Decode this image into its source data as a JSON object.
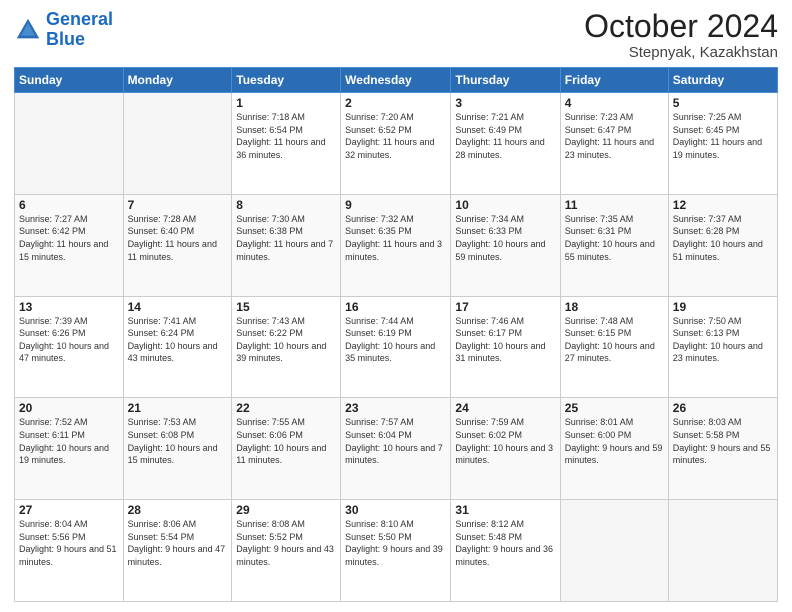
{
  "header": {
    "logo_line1": "General",
    "logo_line2": "Blue",
    "month_title": "October 2024",
    "location": "Stepnyak, Kazakhstan"
  },
  "weekdays": [
    "Sunday",
    "Monday",
    "Tuesday",
    "Wednesday",
    "Thursday",
    "Friday",
    "Saturday"
  ],
  "weeks": [
    [
      {
        "day": "",
        "sunrise": "",
        "sunset": "",
        "daylight": ""
      },
      {
        "day": "",
        "sunrise": "",
        "sunset": "",
        "daylight": ""
      },
      {
        "day": "1",
        "sunrise": "Sunrise: 7:18 AM",
        "sunset": "Sunset: 6:54 PM",
        "daylight": "Daylight: 11 hours and 36 minutes."
      },
      {
        "day": "2",
        "sunrise": "Sunrise: 7:20 AM",
        "sunset": "Sunset: 6:52 PM",
        "daylight": "Daylight: 11 hours and 32 minutes."
      },
      {
        "day": "3",
        "sunrise": "Sunrise: 7:21 AM",
        "sunset": "Sunset: 6:49 PM",
        "daylight": "Daylight: 11 hours and 28 minutes."
      },
      {
        "day": "4",
        "sunrise": "Sunrise: 7:23 AM",
        "sunset": "Sunset: 6:47 PM",
        "daylight": "Daylight: 11 hours and 23 minutes."
      },
      {
        "day": "5",
        "sunrise": "Sunrise: 7:25 AM",
        "sunset": "Sunset: 6:45 PM",
        "daylight": "Daylight: 11 hours and 19 minutes."
      }
    ],
    [
      {
        "day": "6",
        "sunrise": "Sunrise: 7:27 AM",
        "sunset": "Sunset: 6:42 PM",
        "daylight": "Daylight: 11 hours and 15 minutes."
      },
      {
        "day": "7",
        "sunrise": "Sunrise: 7:28 AM",
        "sunset": "Sunset: 6:40 PM",
        "daylight": "Daylight: 11 hours and 11 minutes."
      },
      {
        "day": "8",
        "sunrise": "Sunrise: 7:30 AM",
        "sunset": "Sunset: 6:38 PM",
        "daylight": "Daylight: 11 hours and 7 minutes."
      },
      {
        "day": "9",
        "sunrise": "Sunrise: 7:32 AM",
        "sunset": "Sunset: 6:35 PM",
        "daylight": "Daylight: 11 hours and 3 minutes."
      },
      {
        "day": "10",
        "sunrise": "Sunrise: 7:34 AM",
        "sunset": "Sunset: 6:33 PM",
        "daylight": "Daylight: 10 hours and 59 minutes."
      },
      {
        "day": "11",
        "sunrise": "Sunrise: 7:35 AM",
        "sunset": "Sunset: 6:31 PM",
        "daylight": "Daylight: 10 hours and 55 minutes."
      },
      {
        "day": "12",
        "sunrise": "Sunrise: 7:37 AM",
        "sunset": "Sunset: 6:28 PM",
        "daylight": "Daylight: 10 hours and 51 minutes."
      }
    ],
    [
      {
        "day": "13",
        "sunrise": "Sunrise: 7:39 AM",
        "sunset": "Sunset: 6:26 PM",
        "daylight": "Daylight: 10 hours and 47 minutes."
      },
      {
        "day": "14",
        "sunrise": "Sunrise: 7:41 AM",
        "sunset": "Sunset: 6:24 PM",
        "daylight": "Daylight: 10 hours and 43 minutes."
      },
      {
        "day": "15",
        "sunrise": "Sunrise: 7:43 AM",
        "sunset": "Sunset: 6:22 PM",
        "daylight": "Daylight: 10 hours and 39 minutes."
      },
      {
        "day": "16",
        "sunrise": "Sunrise: 7:44 AM",
        "sunset": "Sunset: 6:19 PM",
        "daylight": "Daylight: 10 hours and 35 minutes."
      },
      {
        "day": "17",
        "sunrise": "Sunrise: 7:46 AM",
        "sunset": "Sunset: 6:17 PM",
        "daylight": "Daylight: 10 hours and 31 minutes."
      },
      {
        "day": "18",
        "sunrise": "Sunrise: 7:48 AM",
        "sunset": "Sunset: 6:15 PM",
        "daylight": "Daylight: 10 hours and 27 minutes."
      },
      {
        "day": "19",
        "sunrise": "Sunrise: 7:50 AM",
        "sunset": "Sunset: 6:13 PM",
        "daylight": "Daylight: 10 hours and 23 minutes."
      }
    ],
    [
      {
        "day": "20",
        "sunrise": "Sunrise: 7:52 AM",
        "sunset": "Sunset: 6:11 PM",
        "daylight": "Daylight: 10 hours and 19 minutes."
      },
      {
        "day": "21",
        "sunrise": "Sunrise: 7:53 AM",
        "sunset": "Sunset: 6:08 PM",
        "daylight": "Daylight: 10 hours and 15 minutes."
      },
      {
        "day": "22",
        "sunrise": "Sunrise: 7:55 AM",
        "sunset": "Sunset: 6:06 PM",
        "daylight": "Daylight: 10 hours and 11 minutes."
      },
      {
        "day": "23",
        "sunrise": "Sunrise: 7:57 AM",
        "sunset": "Sunset: 6:04 PM",
        "daylight": "Daylight: 10 hours and 7 minutes."
      },
      {
        "day": "24",
        "sunrise": "Sunrise: 7:59 AM",
        "sunset": "Sunset: 6:02 PM",
        "daylight": "Daylight: 10 hours and 3 minutes."
      },
      {
        "day": "25",
        "sunrise": "Sunrise: 8:01 AM",
        "sunset": "Sunset: 6:00 PM",
        "daylight": "Daylight: 9 hours and 59 minutes."
      },
      {
        "day": "26",
        "sunrise": "Sunrise: 8:03 AM",
        "sunset": "Sunset: 5:58 PM",
        "daylight": "Daylight: 9 hours and 55 minutes."
      }
    ],
    [
      {
        "day": "27",
        "sunrise": "Sunrise: 8:04 AM",
        "sunset": "Sunset: 5:56 PM",
        "daylight": "Daylight: 9 hours and 51 minutes."
      },
      {
        "day": "28",
        "sunrise": "Sunrise: 8:06 AM",
        "sunset": "Sunset: 5:54 PM",
        "daylight": "Daylight: 9 hours and 47 minutes."
      },
      {
        "day": "29",
        "sunrise": "Sunrise: 8:08 AM",
        "sunset": "Sunset: 5:52 PM",
        "daylight": "Daylight: 9 hours and 43 minutes."
      },
      {
        "day": "30",
        "sunrise": "Sunrise: 8:10 AM",
        "sunset": "Sunset: 5:50 PM",
        "daylight": "Daylight: 9 hours and 39 minutes."
      },
      {
        "day": "31",
        "sunrise": "Sunrise: 8:12 AM",
        "sunset": "Sunset: 5:48 PM",
        "daylight": "Daylight: 9 hours and 36 minutes."
      },
      {
        "day": "",
        "sunrise": "",
        "sunset": "",
        "daylight": ""
      },
      {
        "day": "",
        "sunrise": "",
        "sunset": "",
        "daylight": ""
      }
    ]
  ]
}
